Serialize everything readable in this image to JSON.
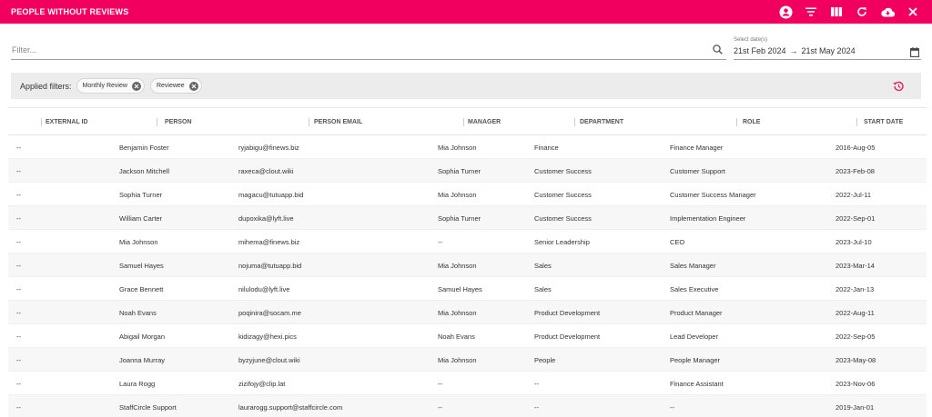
{
  "header": {
    "title": "PEOPLE WITHOUT REVIEWS",
    "accent_color": "#f2005f",
    "actions": [
      {
        "name": "user-icon"
      },
      {
        "name": "filter-icon"
      },
      {
        "name": "columns-icon"
      },
      {
        "name": "refresh-icon"
      },
      {
        "name": "cloud-download-icon"
      },
      {
        "name": "close-icon"
      }
    ]
  },
  "filter": {
    "placeholder": "Filter...",
    "value": ""
  },
  "date_range": {
    "label": "Select date(s)",
    "start": "21st Feb 2024",
    "arrow": "→",
    "end": "21st May 2024"
  },
  "applied_filters": {
    "label": "Applied filters:",
    "chips": [
      "Monthly Review",
      "Reviewee"
    ]
  },
  "table": {
    "columns": [
      "EXTERNAL ID",
      "PERSON",
      "PERSON EMAIL",
      "MANAGER",
      "DEPARTMENT",
      "ROLE",
      "START DATE"
    ],
    "rows": [
      [
        "--",
        "Benjamin Foster",
        "ryjabigu@finews.biz",
        "Mia Johnson",
        "Finance",
        "Finance Manager",
        "2016-Aug-05"
      ],
      [
        "--",
        "Jackson Mitchell",
        "raxeca@clout.wiki",
        "Sophia Turner",
        "Customer Success",
        "Customer Support",
        "2023-Feb-08"
      ],
      [
        "--",
        "Sophia Turner",
        "magacu@tutuapp.bid",
        "Mia Johnson",
        "Customer Success",
        "Customer Success Manager",
        "2022-Jul-11"
      ],
      [
        "--",
        "William Carter",
        "dupoxika@lyft.live",
        "Sophia Turner",
        "Customer Success",
        "Implementation Engineer",
        "2022-Sep-01"
      ],
      [
        "--",
        "Mia Johnson",
        "mihema@finews.biz",
        "--",
        "Senior Leadership",
        "CEO",
        "2023-Jul-10"
      ],
      [
        "--",
        "Samuel Hayes",
        "nojuma@tutuapp.bid",
        "Mia Johnson",
        "Sales",
        "Sales Manager",
        "2023-Mar-14"
      ],
      [
        "--",
        "Grace Bennett",
        "nilulodu@lyft.live",
        "Samuel Hayes",
        "Sales",
        "Sales Executive",
        "2022-Jan-13"
      ],
      [
        "--",
        "Noah Evans",
        "poqinira@socam.me",
        "Mia Johnson",
        "Product Development",
        "Product Manager",
        "2022-Aug-11"
      ],
      [
        "--",
        "Abigail Morgan",
        "kidizagy@hexi.pics",
        "Noah Evans",
        "Product Development",
        "Lead Developer",
        "2022-Sep-05"
      ],
      [
        "--",
        "Joanna Murray",
        "byzyjune@clout.wiki",
        "Mia Johnson",
        "People",
        "People Manager",
        "2023-May-08"
      ],
      [
        "--",
        "Laura Rogg",
        "zizifojy@clip.lat",
        "--",
        "--",
        "Finance Assistant",
        "2023-Nov-06"
      ],
      [
        "--",
        "StaffCircle Support",
        "laurarogg.support@staffcircle.com",
        "--",
        "--",
        "--",
        "2019-Jan-01"
      ]
    ]
  }
}
